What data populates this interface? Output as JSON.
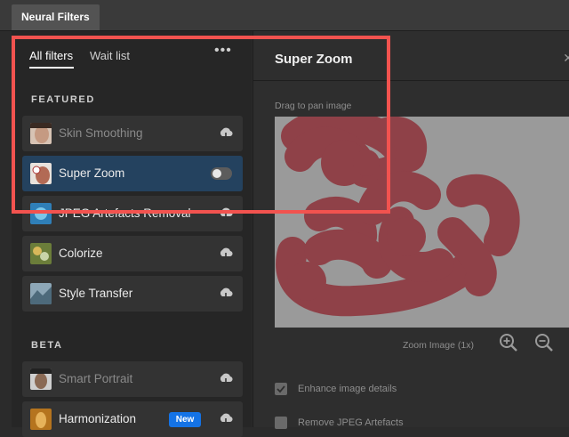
{
  "window": {
    "doc_tab": "Neural Filters"
  },
  "left_panel": {
    "tabs": [
      "All filters",
      "Wait list"
    ],
    "more_label": "•••",
    "sections": {
      "featured": "FEATURED",
      "beta": "BETA"
    },
    "featured_items": [
      {
        "label": "Skin Smoothing",
        "state": "cloud-download",
        "disabled": true
      },
      {
        "label": "Super Zoom",
        "state": "toggle-off",
        "selected": true
      },
      {
        "label": "JPEG Artefacts Removal",
        "state": "cloud-download"
      },
      {
        "label": "Colorize",
        "state": "cloud-download"
      },
      {
        "label": "Style Transfer",
        "state": "cloud-download"
      }
    ],
    "beta_items": [
      {
        "label": "Smart Portrait",
        "state": "cloud-download",
        "disabled": true
      },
      {
        "label": "Harmonization",
        "state": "cloud-download",
        "badge": "New"
      }
    ]
  },
  "right_panel": {
    "title": "Super Zoom",
    "drag_hint": "Drag to pan image",
    "zoom_label": "Zoom Image (1x)",
    "options": [
      {
        "label": "Enhance image details",
        "checked": true
      },
      {
        "label": "Remove JPEG Artefacts",
        "checked": false
      }
    ]
  },
  "colors": {
    "selected_item": "#24425f",
    "highlight_box": "#f2534f",
    "mask": "#8f4148",
    "badge": "#1473e6"
  }
}
